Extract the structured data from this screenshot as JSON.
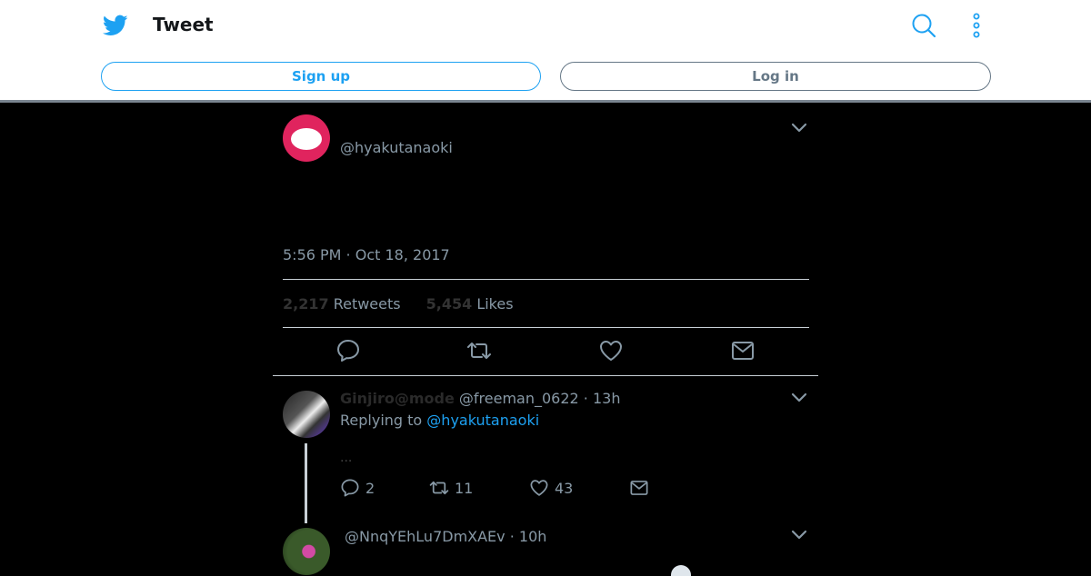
{
  "header": {
    "title": "Tweet",
    "signup_label": "Sign up",
    "login_label": "Log in",
    "brand_color": "#1da1f2"
  },
  "tweet": {
    "handle": "@hyakutanaoki",
    "timestamp": "5:56 PM · Oct 18, 2017",
    "retweets_count": "2,217",
    "retweets_label": "Retweets",
    "likes_count": "5,454",
    "likes_label": "Likes"
  },
  "replies": [
    {
      "name": "Ginjiro@mode",
      "meta": "@freeman_0622 · 13h",
      "replying_prefix": "Replying to",
      "replying_handle": "@hyakutanaoki",
      "text": "...",
      "reply_count": "2",
      "retweet_count": "11",
      "like_count": "43"
    },
    {
      "meta": "@NnqYEhLu7DmXAEv · 10h"
    }
  ]
}
